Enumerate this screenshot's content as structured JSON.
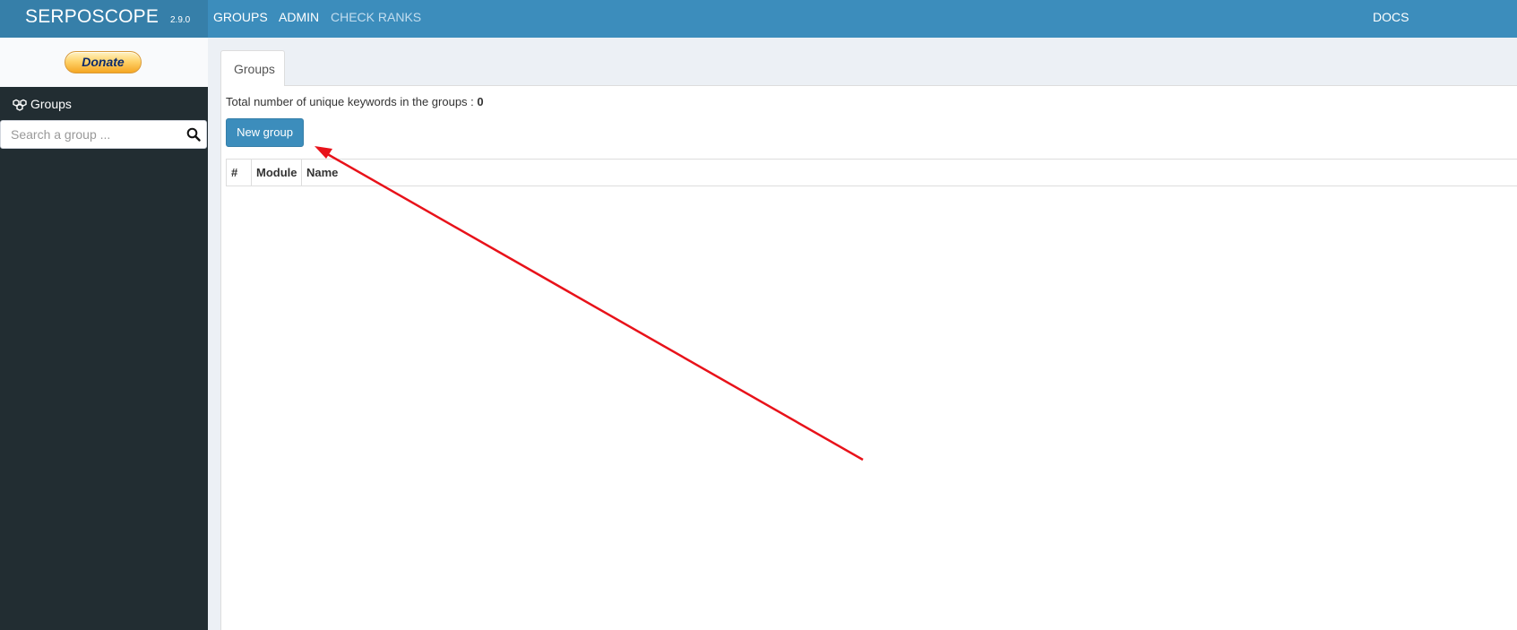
{
  "navbar": {
    "brand": "SERPOSCOPE",
    "version": "2.9.0",
    "links": [
      "GROUPS",
      "ADMIN",
      "CHECK RANKS"
    ],
    "right_link": "DOCS"
  },
  "sidebar": {
    "donate_label": "Donate",
    "section_label": "Groups",
    "search_placeholder": "Search a group ..."
  },
  "main": {
    "tab_label": "Groups",
    "total_label": "Total number of unique keywords in the groups :",
    "total_value": "0",
    "new_group_label": "New group",
    "table_headers": [
      "#",
      "Module",
      "Name"
    ]
  },
  "colors": {
    "navbar": "#3c8dbc",
    "brand_bg": "#367fa9",
    "sidebar": "#222d32",
    "content_bg": "#ecf0f5",
    "annotation_arrow": "#e8121a"
  },
  "icons": {
    "groups": "cubes-icon",
    "search": "search-icon"
  }
}
